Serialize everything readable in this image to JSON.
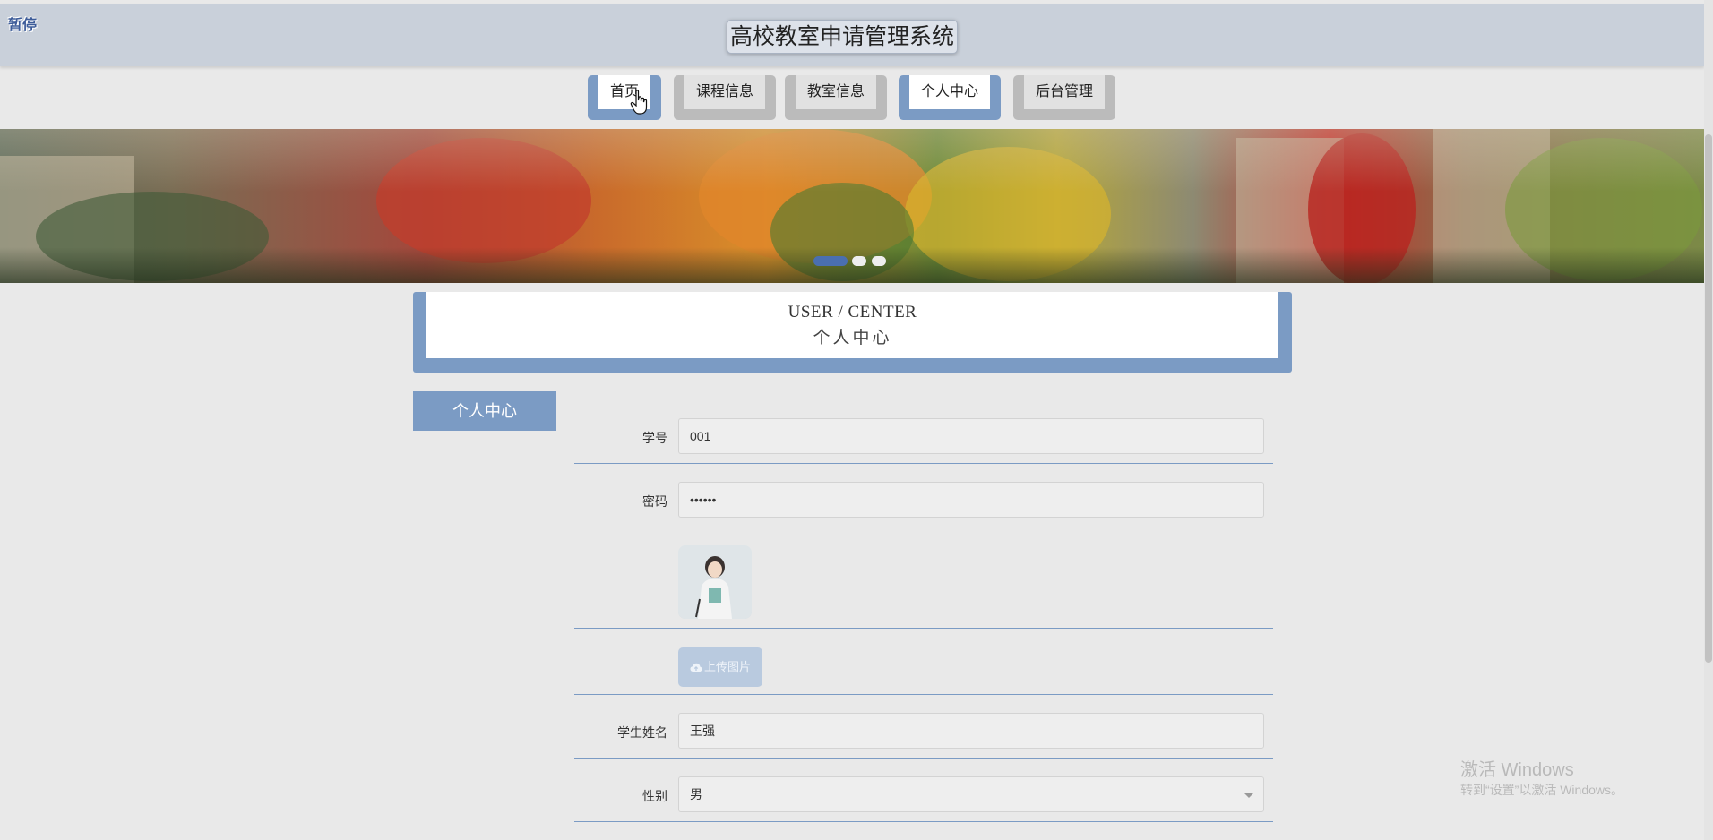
{
  "header": {
    "pause_label": "暂停",
    "title": "高校教室申请管理系统"
  },
  "nav": {
    "items": [
      {
        "label": "首页",
        "active": true
      },
      {
        "label": "课程信息",
        "active": false
      },
      {
        "label": "教室信息",
        "active": false
      },
      {
        "label": "个人中心",
        "active": true
      },
      {
        "label": "后台管理",
        "active": false
      }
    ]
  },
  "banner": {
    "slide_count": 3,
    "active_slide": 1
  },
  "section": {
    "title_en": "USER / CENTER",
    "title_cn": "个人中心"
  },
  "sidebar": {
    "items": [
      {
        "label": "个人中心"
      }
    ]
  },
  "form": {
    "student_id": {
      "label": "学号",
      "value": "001"
    },
    "password": {
      "label": "密码",
      "value": "••••••"
    },
    "avatar": {
      "label": ""
    },
    "upload": {
      "label": "上传图片",
      "icon": "cloud-upload-icon"
    },
    "student_name": {
      "label": "学生姓名",
      "value": "王强"
    },
    "gender": {
      "label": "性别",
      "value": "男"
    }
  },
  "watermark": {
    "title": "激活 Windows",
    "subtitle": "转到“设置”以激活 Windows。"
  },
  "colors": {
    "accent": "#7b9bc4",
    "header_bg": "#c9d0da",
    "page_bg": "#e9e9e9"
  }
}
